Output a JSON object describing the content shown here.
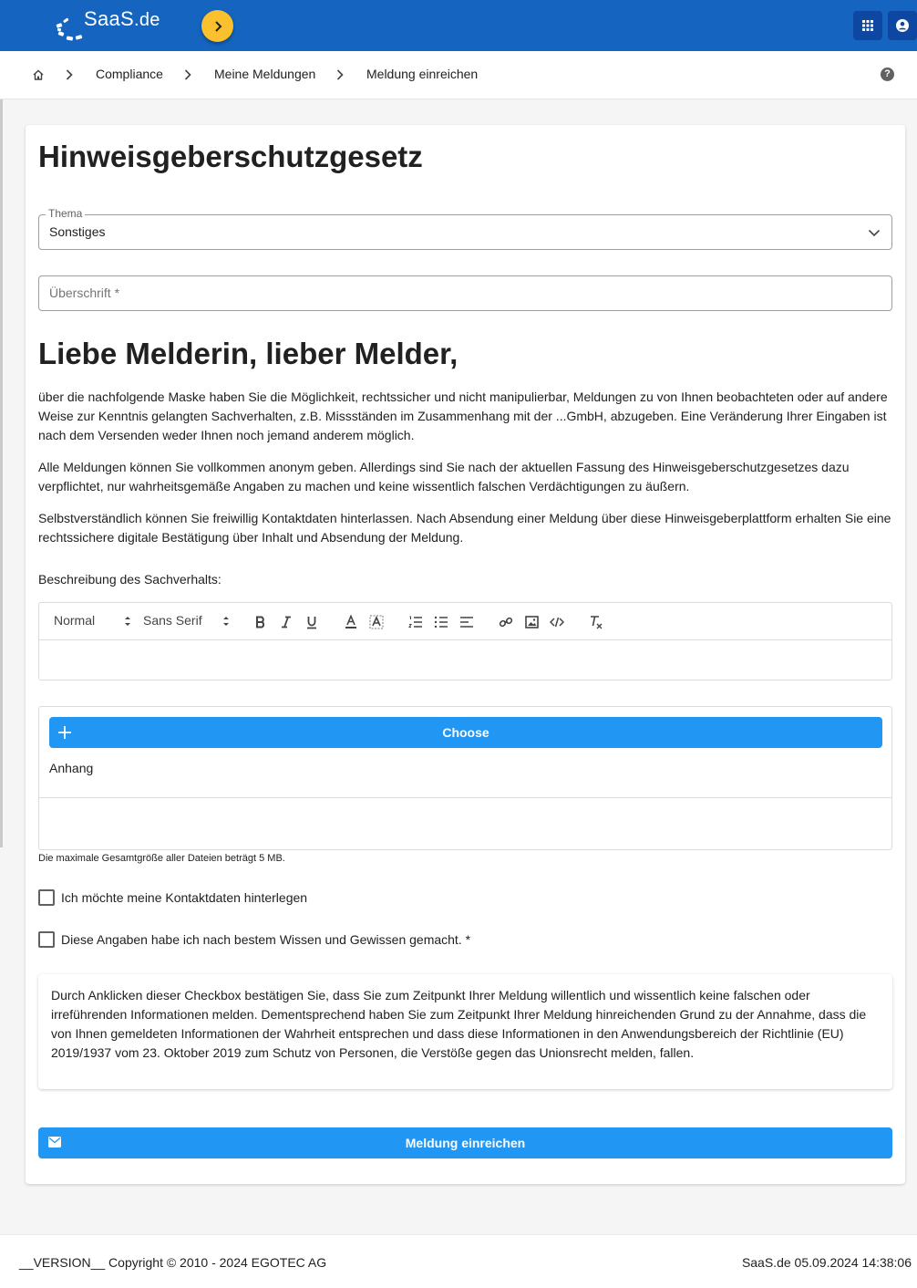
{
  "app": {
    "brand": "SaaS",
    "brand_tld": ".de"
  },
  "breadcrumb": {
    "items": [
      "Compliance",
      "Meine Meldungen",
      "Meldung einreichen"
    ]
  },
  "form": {
    "title": "Hinweisgeberschutzgesetz",
    "topic": {
      "label": "Thema",
      "value": "Sonstiges"
    },
    "heading_field": {
      "placeholder": "Überschrift *"
    },
    "greeting": "Liebe Melderin, lieber Melder,",
    "paragraphs": [
      "über die nachfolgende Maske haben Sie die Möglichkeit, rechtssicher und nicht manipulierbar, Meldungen zu von Ihnen beobachteten oder auf andere Weise zur Kenntnis gelangten Sachverhalten, z.B. Missständen im Zusammenhang mit der ...GmbH, abzugeben. Eine Veränderung Ihrer Eingaben ist nach dem Versenden weder Ihnen noch jemand anderem möglich.",
      "Alle Meldungen können Sie vollkommen anonym geben. Allerdings sind Sie nach der aktuellen Fassung des Hinweisgeberschutzgesetzes dazu verpflichtet, nur wahrheitsgemäße Angaben zu machen und keine wissentlich falschen Verdächtigungen zu äußern.",
      "Selbstverständlich können Sie freiwillig Kontaktdaten hinterlassen. Nach Absendung einer Meldung über diese Hinweisgeberplattform erhalten Sie eine rechtssichere digitale Bestätigung über Inhalt und Absendung der Meldung."
    ],
    "description_label": "Beschreibung des Sachverhalts:",
    "editor": {
      "size": "Normal",
      "font": "Sans Serif"
    },
    "upload": {
      "choose_label": "Choose",
      "attachment_label": "Anhang",
      "hint": "Die maximale Gesamtgröße aller Dateien beträgt 5 MB."
    },
    "checkboxes": [
      {
        "label": "Ich möchte meine Kontaktdaten hinterlegen",
        "checked": false
      },
      {
        "label": "Diese Angaben habe ich nach bestem Wissen und Gewissen gemacht. *",
        "checked": false
      }
    ],
    "notice": "Durch Anklicken dieser Checkbox bestätigen Sie, dass Sie zum Zeitpunkt Ihrer Meldung willentlich und wissentlich keine falschen oder irreführenden Informationen melden. Dementsprechend haben Sie zum Zeitpunkt Ihrer Meldung hinreichenden Grund zu der Annahme, dass die von Ihnen gemeldeten Informationen der Wahrheit entsprechen und dass diese Informationen in den Anwendungsbereich der Richtlinie (EU) 2019/1937 vom 23. Oktober 2019 zum Schutz von Personen, die Verstöße gegen das Unionsrecht melden, fallen.",
    "submit_label": "Meldung einreichen"
  },
  "footer": {
    "left": "__VERSION__ Copyright © 2010 - 2024 EGOTEC AG",
    "right": "SaaS.de  05.09.2024 14:38:06"
  },
  "colors": {
    "topbar": "#1565c0",
    "accent": "#2196f3",
    "nav_toggle": "#fbc02d"
  }
}
